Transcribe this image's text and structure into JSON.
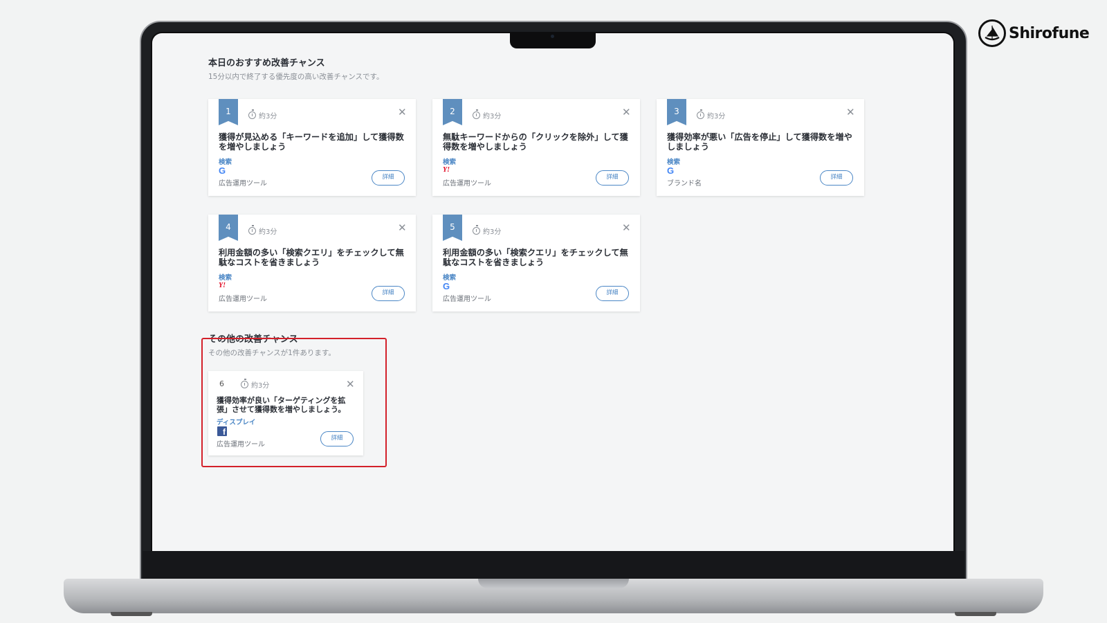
{
  "brand": {
    "name": "Shirofune",
    "logo_icon": "boat-icon"
  },
  "today": {
    "title": "本日のおすすめ改善チャンス",
    "subtitle": "15分以内で終了する優先度の高い改善チャンスです。",
    "cards": [
      {
        "rank": "1",
        "time": "約3分",
        "title_line1": "獲得が見込める「キーワードを追加」して獲得数",
        "title_line2": "を増やしましょう",
        "category": "検索",
        "platform": "google",
        "platform_glyph": "G",
        "tool": "広告運用ツール",
        "detail": "詳細"
      },
      {
        "rank": "2",
        "time": "約3分",
        "title_line1": "無駄キーワードからの「クリックを除外」して獲",
        "title_line2": "得数を増やしましょう",
        "category": "検索",
        "platform": "yahoo",
        "platform_glyph": "Y!",
        "tool": "広告運用ツール",
        "detail": "詳細"
      },
      {
        "rank": "3",
        "time": "約3分",
        "title_line1": "獲得効率が悪い「広告を停止」して獲得数を増や",
        "title_line2": "しましょう",
        "category": "検索",
        "platform": "google",
        "platform_glyph": "G",
        "tool": "ブランド名",
        "detail": "詳細"
      },
      {
        "rank": "4",
        "time": "約3分",
        "title_line1": "利用金額の多い「検索クエリ」をチェックして無",
        "title_line2": "駄なコストを省きましょう",
        "category": "検索",
        "platform": "yahoo",
        "platform_glyph": "Y!",
        "tool": "広告運用ツール",
        "detail": "詳細"
      },
      {
        "rank": "5",
        "time": "約3分",
        "title_line1": "利用金額の多い「検索クエリ」をチェックして無",
        "title_line2": "駄なコストを省きましょう",
        "category": "検索",
        "platform": "google",
        "platform_glyph": "G",
        "tool": "広告運用ツール",
        "detail": "詳細"
      }
    ]
  },
  "other": {
    "title": "その他の改善チャンス",
    "subtitle": "その他の改善チャンスが1件あります。",
    "card": {
      "rank": "6",
      "time": "約3分",
      "title_line1": "獲得効率が良い「ターゲティングを拡",
      "title_line2": "張」させて獲得数を増やしましょう。",
      "category": "ディスプレイ",
      "platform": "facebook",
      "platform_glyph": "f",
      "tool": "広告運用ツール",
      "detail": "詳細"
    }
  },
  "colors": {
    "accent": "#4a86c5",
    "ribbon": "#5f8fbe",
    "highlight": "#d3202a"
  }
}
